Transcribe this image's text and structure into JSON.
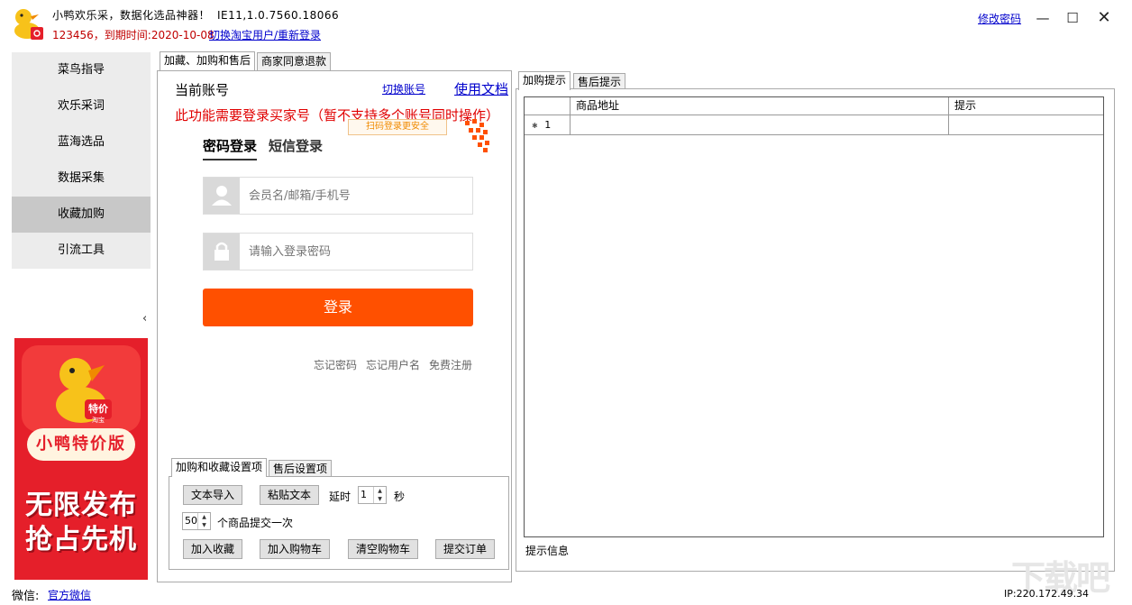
{
  "window": {
    "title": "小鸭欢乐采，数据化选品神器！",
    "version": "IE11,1.0.7560.18066",
    "expire_text": "123456，到期时间:2020-10-08",
    "switch_user": "切换淘宝用户/重新登录",
    "change_password": "修改密码",
    "controls": {
      "minimize": "—",
      "maximize": "☐",
      "close": "✕"
    }
  },
  "sidebar": {
    "items": [
      {
        "label": "菜鸟指导",
        "active": false
      },
      {
        "label": "欢乐采词",
        "active": false
      },
      {
        "label": "蓝海选品",
        "active": false
      },
      {
        "label": "数据采集",
        "active": false
      },
      {
        "label": "收藏加购",
        "active": true
      },
      {
        "label": "引流工具",
        "active": false
      }
    ],
    "collapse": "‹"
  },
  "ad": {
    "logo_tag": "特价",
    "logo_sub": "淘宝",
    "badge": "小鸭特价版",
    "line1": "无限发布",
    "line2": "抢占先机"
  },
  "footer": {
    "wechat_label": "微信:",
    "wechat_link": "官方微信",
    "ip": "IP:220.172.49.34",
    "watermark": "下载吧"
  },
  "main_tabs": [
    {
      "label": "加藏、加购和售后",
      "active": true
    },
    {
      "label": "商家同意退款",
      "active": false
    }
  ],
  "login": {
    "current_account": "当前账号",
    "switch_account": "切换账号",
    "usage_doc": "使用文档",
    "warning": "此功能需要登录买家号（暂不支持多个账号同时操作）",
    "qr_tip": "扫码登录更安全",
    "tab_password": "密码登录",
    "tab_sms": "短信登录",
    "username_placeholder": "会员名/邮箱/手机号",
    "password_placeholder": "请输入登录密码",
    "login_button": "登录",
    "forgot_password": "忘记密码",
    "forgot_username": "忘记用户名",
    "register": "免费注册"
  },
  "settings": {
    "tabs": [
      {
        "label": "加购和收藏设置项",
        "active": true
      },
      {
        "label": "售后设置项",
        "active": false
      }
    ],
    "import_text": "文本导入",
    "paste_text": "粘贴文本",
    "delay_label": "延时",
    "delay_value": "1",
    "delay_unit": "秒",
    "batch_value": "50",
    "batch_label": "个商品提交一次",
    "add_favorite": "加入收藏",
    "add_cart": "加入购物车",
    "clear_cart": "清空购物车",
    "submit_order": "提交订单"
  },
  "right": {
    "tabs": [
      {
        "label": "加购提示",
        "active": true
      },
      {
        "label": "售后提示",
        "active": false
      }
    ],
    "columns": [
      "商品地址",
      "提示"
    ],
    "rows": [
      {
        "marker": "✱",
        "index": "1",
        "url": "",
        "tip": ""
      }
    ],
    "info_label": "提示信息"
  },
  "colors": {
    "accent": "#ff5000",
    "warning": "#e00000",
    "link": "#0000cc",
    "sidebar_bg": "#ececec",
    "sidebar_active": "#c8c8c8",
    "ad_red": "#e51f2a"
  }
}
